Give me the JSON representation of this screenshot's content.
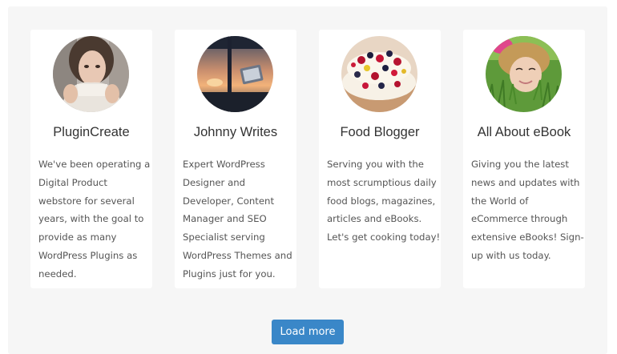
{
  "profiles": [
    {
      "name": "PluginCreate",
      "description_lines": [
        "We've been operating a",
        "Digital Product",
        "webstore for several",
        "years, with the goal to",
        "provide as many",
        "WordPress Plugins as",
        "needed."
      ],
      "avatar": "woman-scarf-photo"
    },
    {
      "name": "Johnny Writes",
      "description_lines": [
        "Expert WordPress",
        "Designer and",
        "Developer, Content",
        "Manager and SEO",
        "Specialist serving",
        "WordPress Themes and",
        "Plugins just for you."
      ],
      "avatar": "window-sunset-photo"
    },
    {
      "name": "Food Blogger",
      "description_lines": [
        "Serving you with the",
        "most scrumptious daily",
        "food blogs, magazines,",
        "articles and eBooks.",
        "Let's get cooking today!"
      ],
      "avatar": "berry-cake-photo"
    },
    {
      "name": "All About eBook",
      "description_lines": [
        "Giving you the latest",
        "news and updates with",
        "the World of",
        "eCommerce through",
        "extensive eBooks! Sign-",
        "up with us today."
      ],
      "avatar": "woman-in-grass-photo"
    }
  ],
  "load_more_label": "Load more",
  "colors": {
    "panel_background": "#f6f6f6",
    "card_background": "#ffffff",
    "button": "#3a87c8"
  }
}
